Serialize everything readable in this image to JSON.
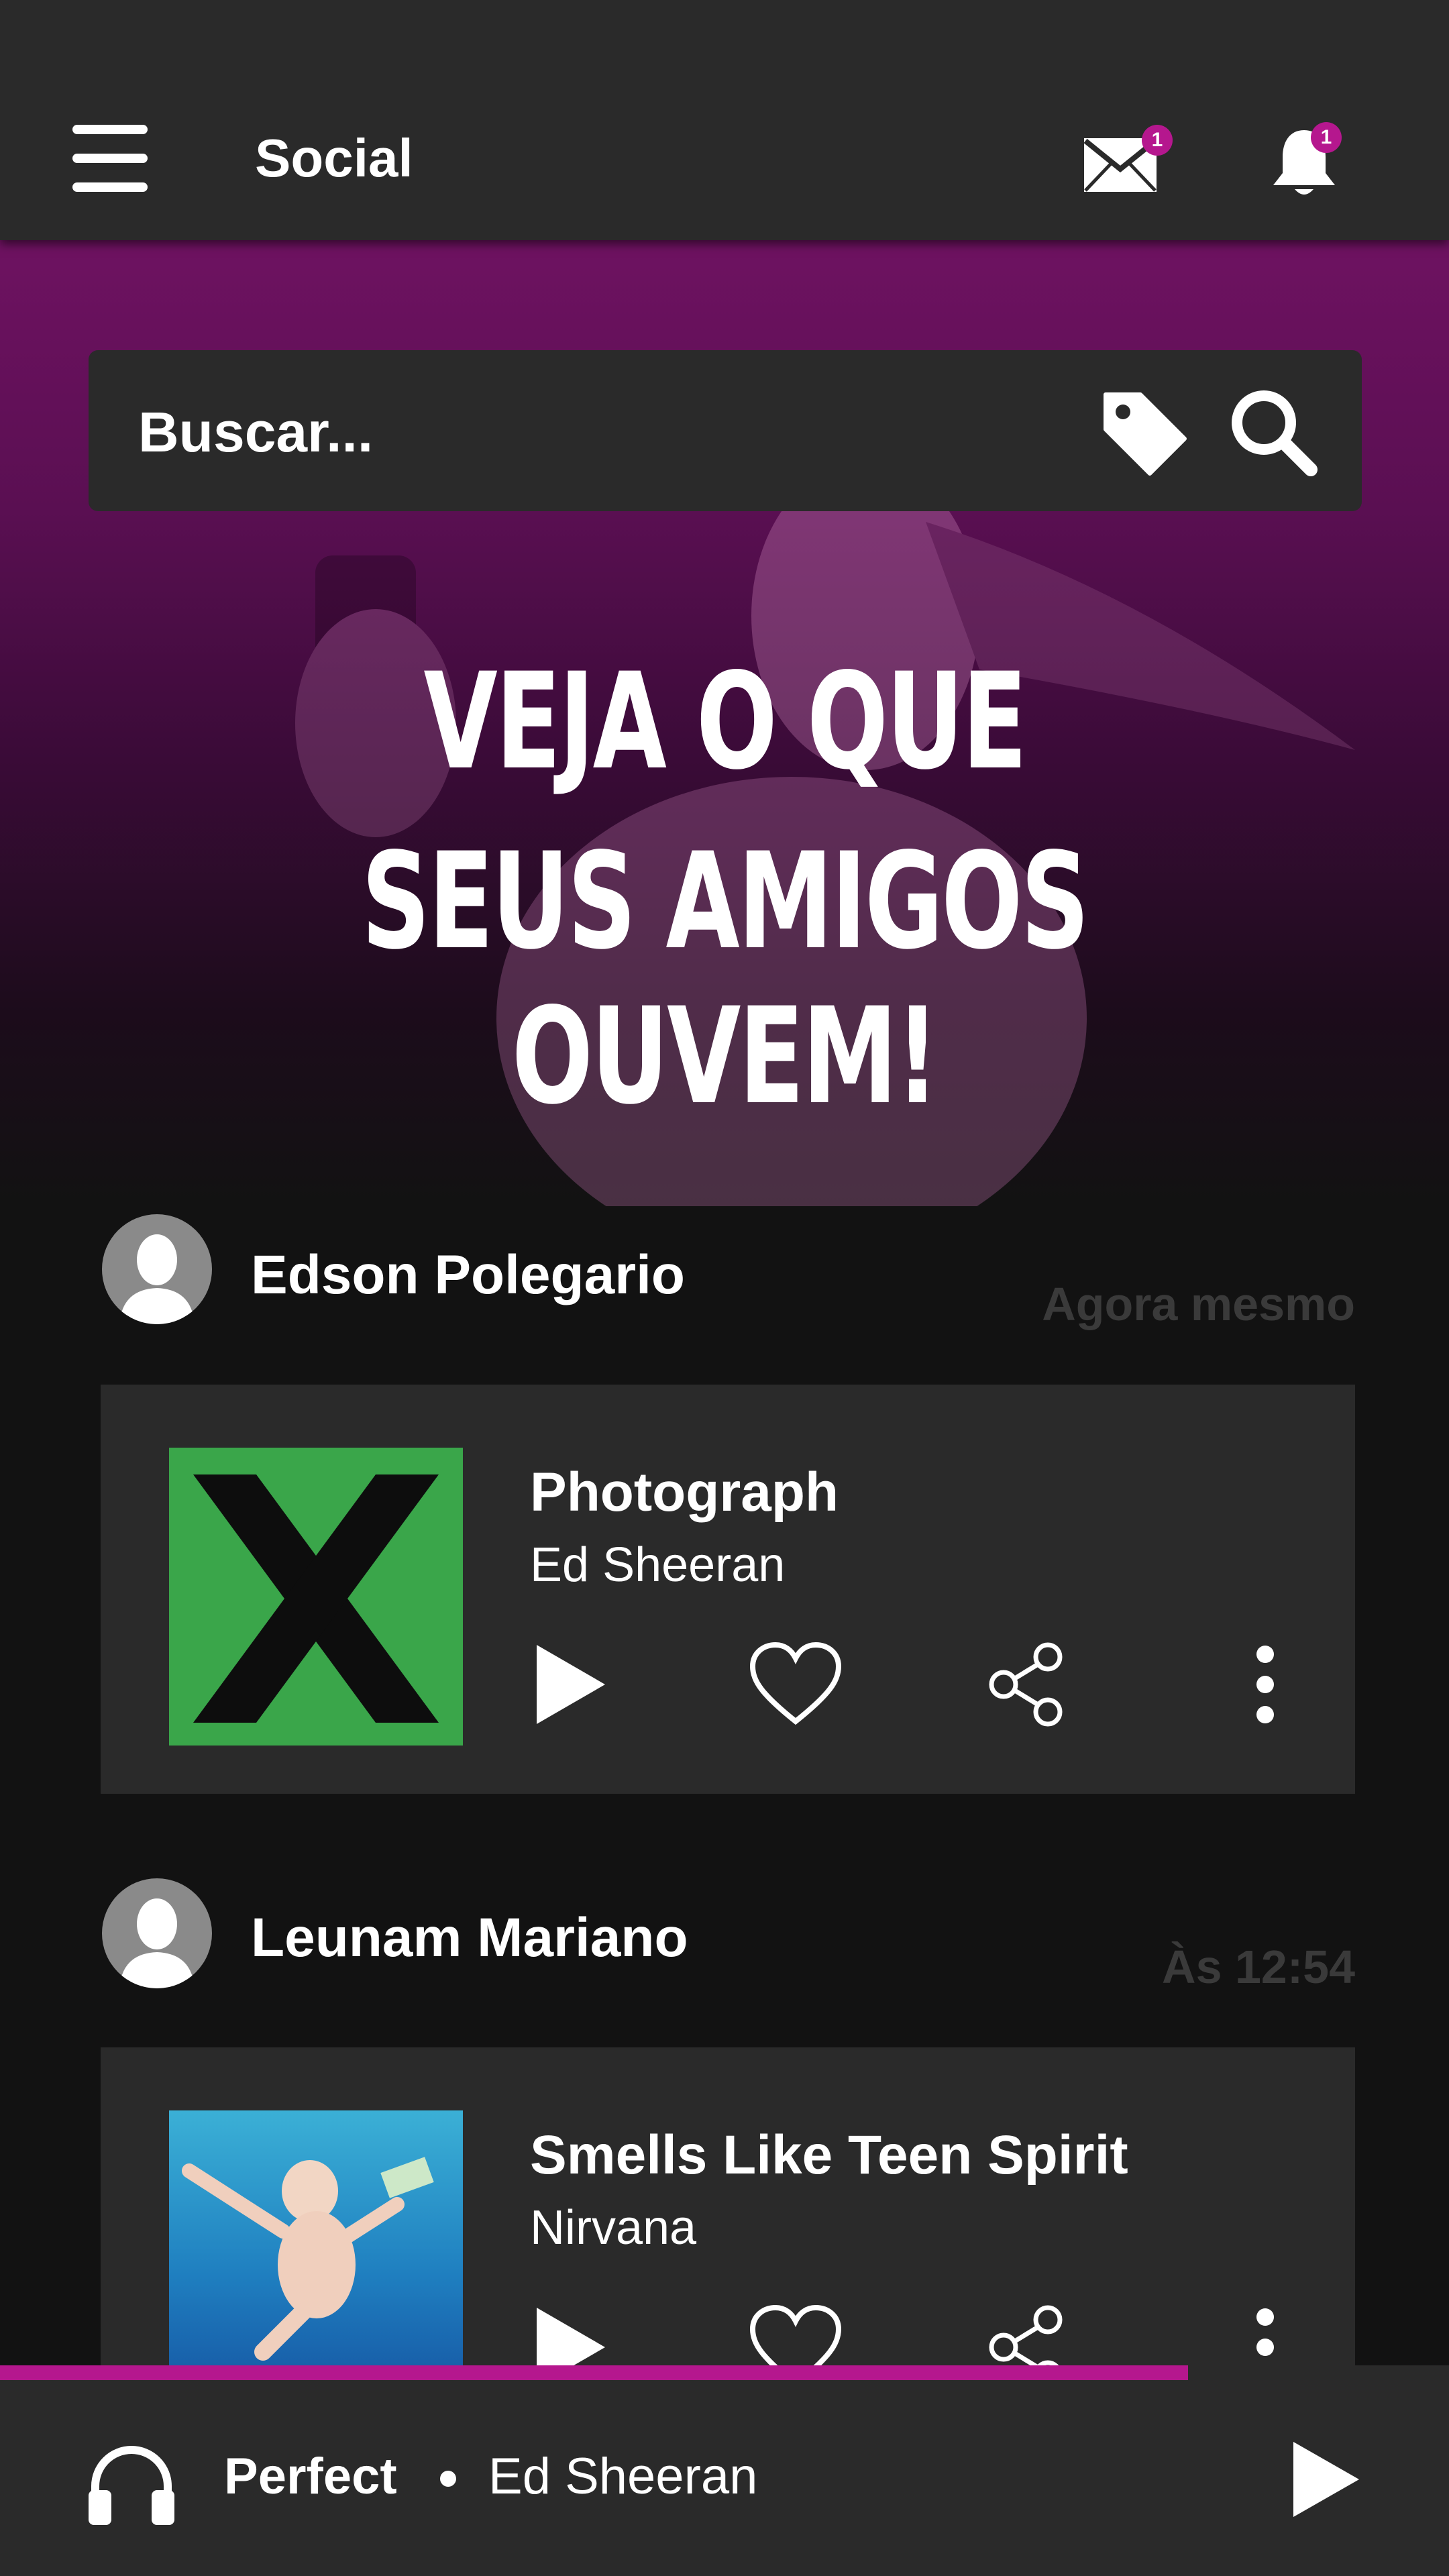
{
  "header": {
    "title": "Social",
    "messages_badge": "1",
    "notifications_badge": "1"
  },
  "search": {
    "placeholder": "Buscar..."
  },
  "hero": {
    "line1": "VEJA O QUE",
    "line2": "SEUS AMIGOS OUVEM!"
  },
  "feed": [
    {
      "user": "Edson Polegario",
      "time": "Agora mesmo",
      "song": "Photograph",
      "artist": "Ed Sheeran"
    },
    {
      "user": "Leunam Mariano",
      "time": "Às 12:54",
      "song": "Smells Like Teen Spirit",
      "artist": "Nirvana"
    }
  ],
  "player": {
    "track": "Perfect",
    "artist": "Ed Sheeran",
    "progress_percent": 82
  },
  "colors": {
    "accent": "#b5178e",
    "header_bg": "#2a2a2a",
    "page_bg": "#121212",
    "card_bg": "#2a2a2a"
  },
  "icons": [
    "menu-icon",
    "mail-icon",
    "bell-icon",
    "tag-icon",
    "search-icon",
    "play-icon",
    "heart-icon",
    "share-icon",
    "more-vertical-icon",
    "headphones-icon"
  ]
}
